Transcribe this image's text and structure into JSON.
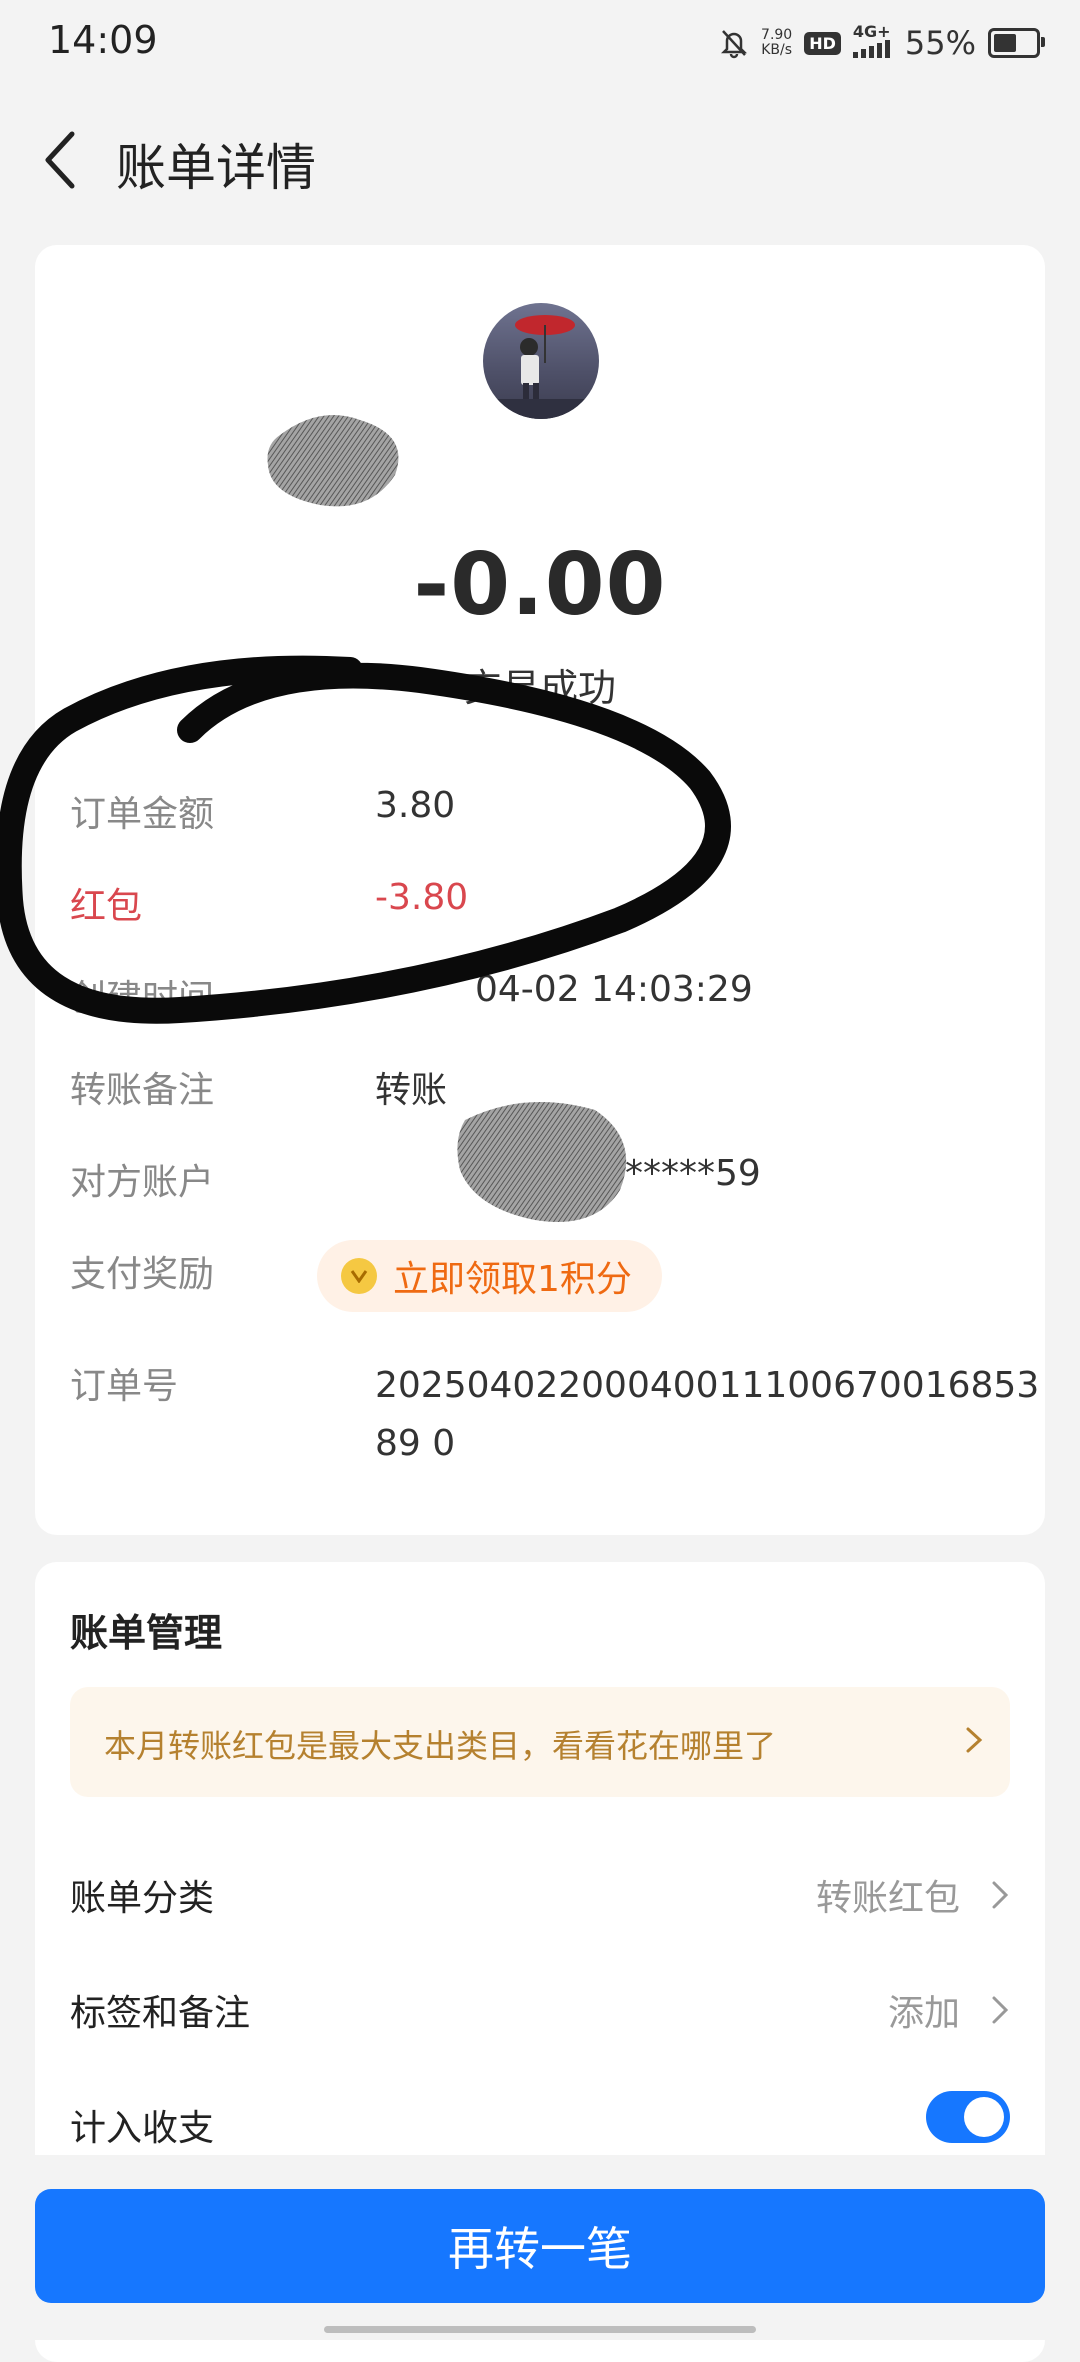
{
  "status_bar": {
    "time": "14:09",
    "speed_value": "7.90",
    "speed_unit": "KB/s",
    "hd": "HD",
    "network": "4G+",
    "battery_percent": "55%",
    "battery_level": 0.55
  },
  "header": {
    "title": "账单详情"
  },
  "summary": {
    "amount": "-0.00",
    "status": "交易成功"
  },
  "details": {
    "order_amount_label": "订单金额",
    "order_amount_value": "3.80",
    "red_packet_label": "红包",
    "red_packet_value": "-3.80",
    "created_label": "创建时间",
    "created_value": "04-02 14:03:29",
    "note_label": "转账备注",
    "note_value": "转账",
    "account_label": "对方账户",
    "account_value": "*****59",
    "reward_label": "支付奖励",
    "reward_button": "立即领取1积分",
    "order_no_label": "订单号",
    "order_no_value": "2025040220004001110067001685389 0"
  },
  "manage": {
    "title": "账单管理",
    "banner": "本月转账红包是最大支出类目，看看花在哪里了",
    "category_label": "账单分类",
    "category_value": "转账红包",
    "tags_label": "标签和备注",
    "tags_value": "添加",
    "income_label": "计入收支",
    "income_on": true
  },
  "footer": {
    "button": "再转一笔"
  },
  "colors": {
    "accent": "#1677ff",
    "red": "#d9474e",
    "orange": "#ef6a12",
    "banner_text": "#b5812f"
  },
  "icons": [
    "back-chevron-icon",
    "mute-icon",
    "coin-icon",
    "chevron-right-icon"
  ]
}
